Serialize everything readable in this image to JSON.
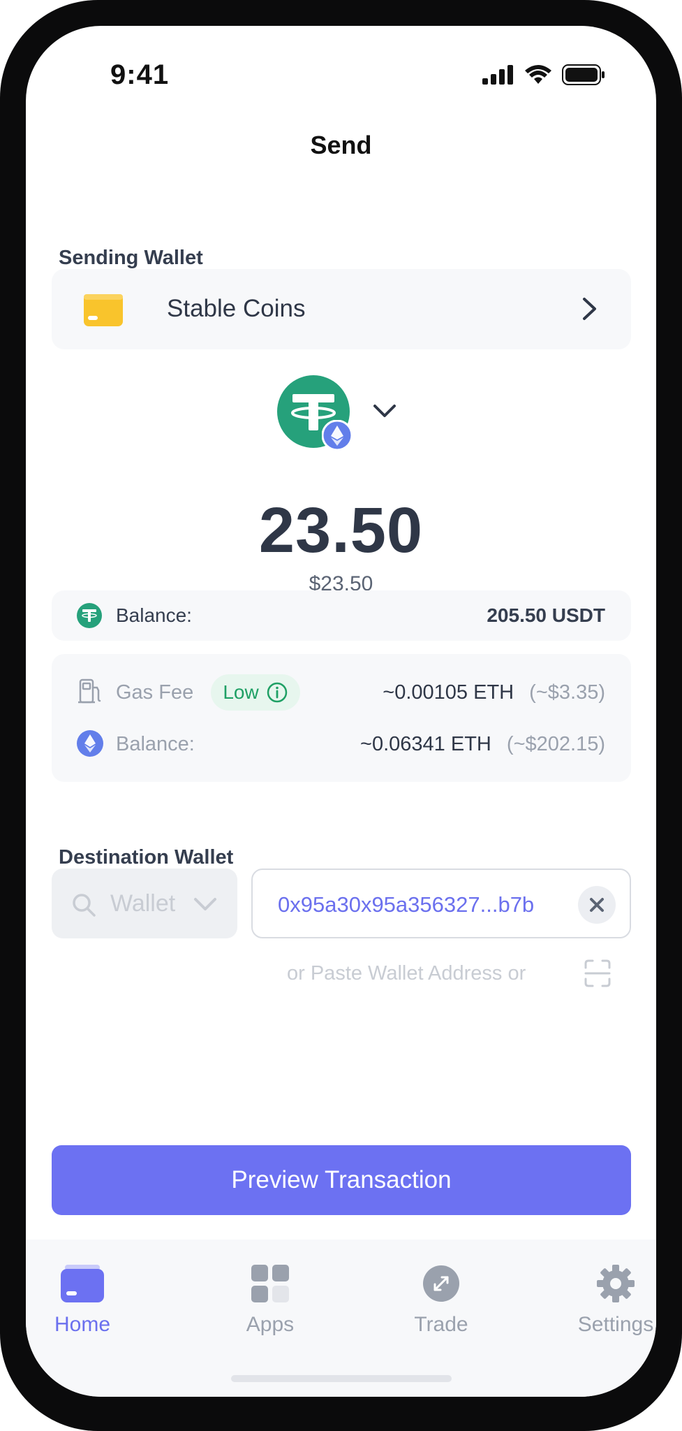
{
  "status_bar": {
    "time": "9:41"
  },
  "header": {
    "title": "Send"
  },
  "sending_wallet": {
    "section_label": "Sending Wallet",
    "wallet_name": "Stable Coins"
  },
  "amount": {
    "value": "23.50",
    "usd": "$23.50"
  },
  "balance": {
    "label": "Balance:",
    "value": "205.50 USDT"
  },
  "gas": {
    "label": "Gas Fee",
    "badge": "Low",
    "value": "~0.00105 ETH",
    "value_usd": "(~$3.35)",
    "balance_label": "Balance:",
    "balance_value": "~0.06341 ETH",
    "balance_usd": "(~$202.15)"
  },
  "destination": {
    "section_label": "Destination Wallet",
    "search_placeholder": "Wallet",
    "address": "0x95a30x95a356327...b7b",
    "paste_hint": "or Paste Wallet Address or"
  },
  "actions": {
    "preview": "Preview Transaction"
  },
  "tabbar": {
    "items": [
      {
        "label": "Home",
        "icon": "card-icon",
        "active": true
      },
      {
        "label": "Apps",
        "icon": "grid-icon",
        "active": false
      },
      {
        "label": "Trade",
        "icon": "trade-icon",
        "active": false
      },
      {
        "label": "Settings",
        "icon": "gear-icon",
        "active": false
      }
    ]
  },
  "colors": {
    "accent": "#6c71f2",
    "tether_green": "#26a17b",
    "ethereum": "#627eea",
    "wallet_yellow": "#f9c42c",
    "low_green": "#1fa065"
  }
}
